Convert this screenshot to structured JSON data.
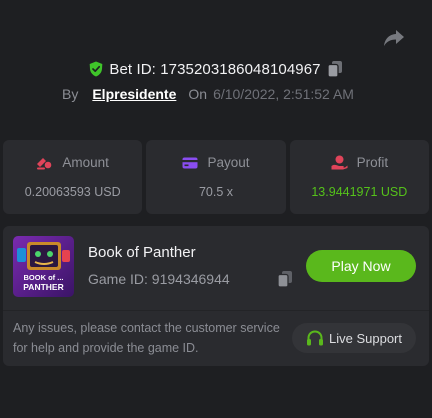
{
  "bet": {
    "id_label": "Bet ID: 1735203186048104967",
    "by_label": "By",
    "user": "Elpresidente",
    "on_label": "On",
    "date": "6/10/2022, 2:51:52 AM"
  },
  "stats": [
    {
      "label": "Amount",
      "value": "0.20063593 USD",
      "icon": "coins-icon",
      "color": "#e0445a"
    },
    {
      "label": "Payout",
      "value": "70.5 x",
      "icon": "card-icon",
      "color": "#8a4df0"
    },
    {
      "label": "Profit",
      "value": "13.9441971 USD",
      "icon": "profit-icon",
      "color": "#e0445a",
      "value_color": "#55c21a"
    }
  ],
  "game": {
    "title": "Book of Panther",
    "id_label": "Game ID: 9194346944",
    "thumb_text": "BOOK of ... PANTHER",
    "play_label": "Play Now"
  },
  "support": {
    "message": "Any issues, please contact the customer service for help and provide the game ID.",
    "button_label": "Live Support"
  },
  "colors": {
    "accent_green": "#5ab81c",
    "shield_green": "#3fc42a",
    "background": "#1e1f22",
    "card": "#2a2b2f"
  }
}
